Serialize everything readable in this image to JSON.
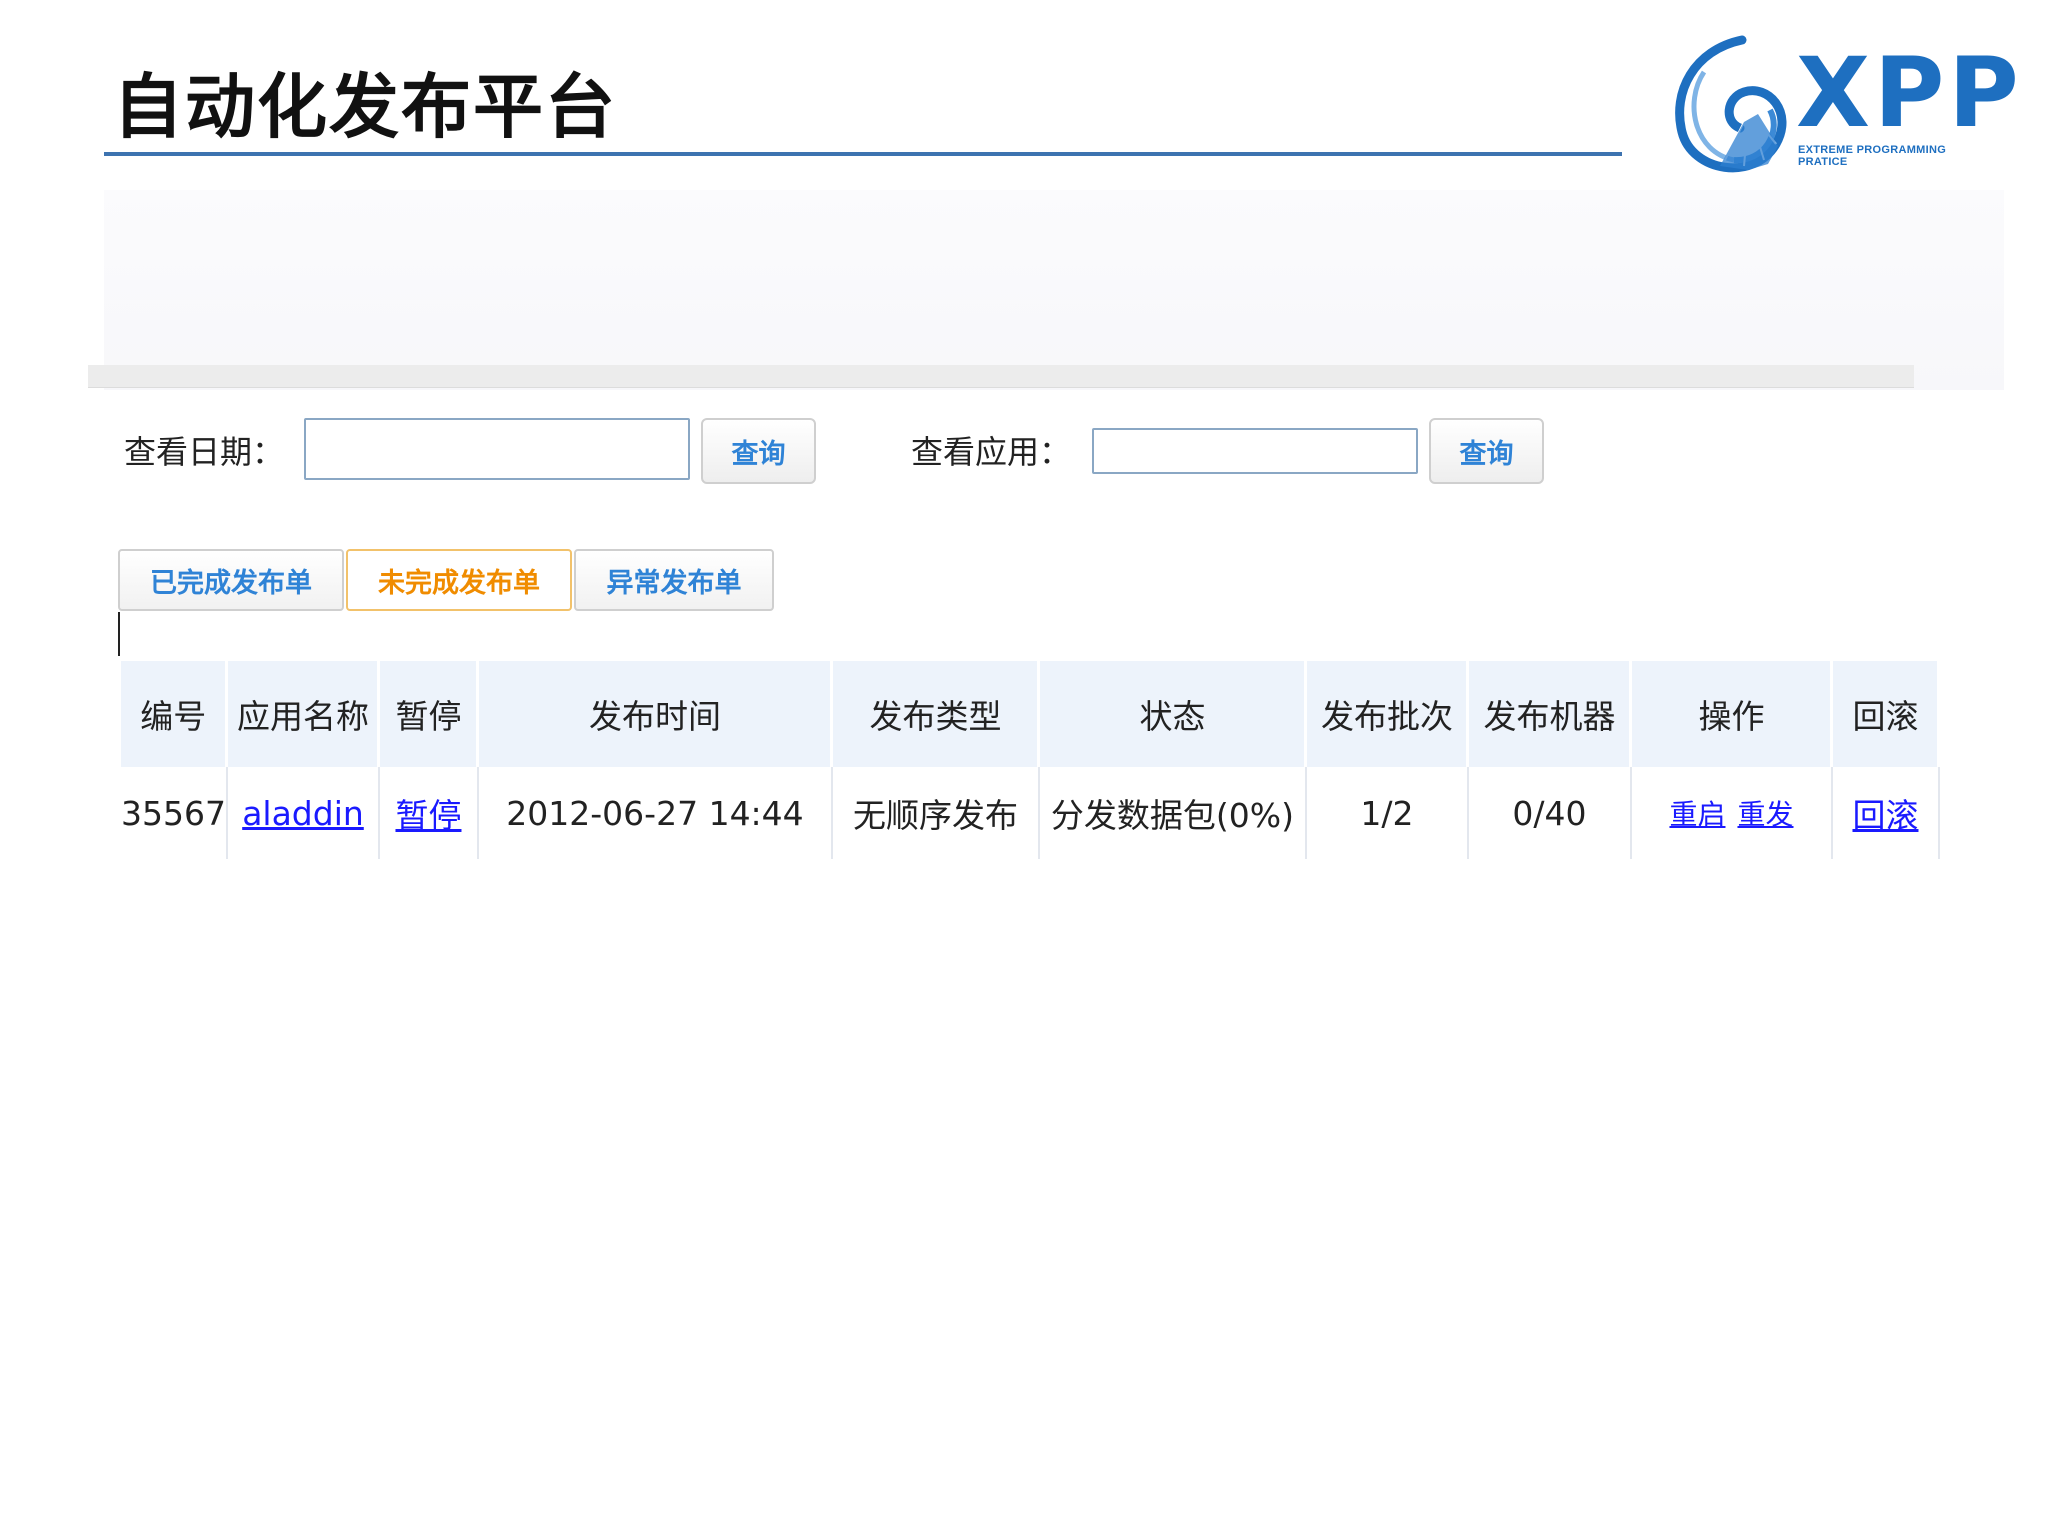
{
  "slide": {
    "title": "自动化发布平台",
    "logo_text": "XPP",
    "logo_subtitle": "EXTREME PROGRAMMING PRATICE"
  },
  "colors": {
    "accent": "#2f83d6",
    "active_tab": "#f08c00",
    "link": "#1a1aff",
    "title_rule": "#3d73b0"
  },
  "query": {
    "date_label": "查看日期：",
    "date_value": "",
    "date_button": "查询",
    "app_label": "查看应用：",
    "app_value": "",
    "app_button": "查询"
  },
  "tabs": [
    {
      "label": "已完成发布单",
      "active": false
    },
    {
      "label": "未完成发布单",
      "active": true
    },
    {
      "label": "异常发布单",
      "active": false
    }
  ],
  "table": {
    "headers": [
      "编号",
      "应用名称",
      "暂停",
      "发布时间",
      "发布类型",
      "状态",
      "发布批次",
      "发布机器",
      "操作",
      "回滚"
    ],
    "rows": [
      {
        "id": "35567",
        "app": "aladdin",
        "pause": "暂停",
        "time": "2012-06-27 14:44",
        "type": "无顺序发布",
        "status": "分发数据包(0%)",
        "batch": "1/2",
        "machines": "0/40",
        "op_restart": "重启",
        "op_redeploy": "重发",
        "rollback": "回滚"
      }
    ]
  }
}
